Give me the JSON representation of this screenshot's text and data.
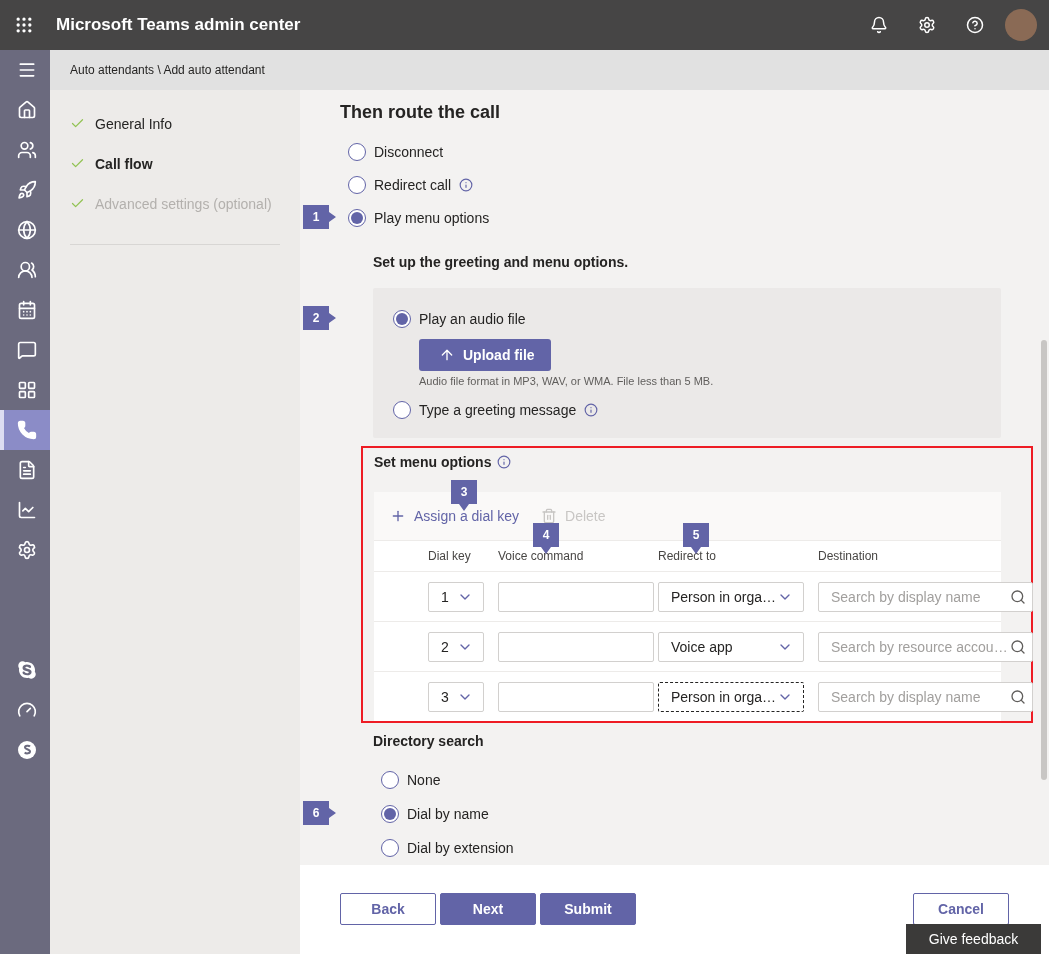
{
  "topbar": {
    "title": "Microsoft Teams admin center"
  },
  "rail": {
    "items": [
      {
        "kind": "menu",
        "selected": false
      },
      {
        "kind": "home",
        "selected": false
      },
      {
        "kind": "teams",
        "selected": false
      },
      {
        "kind": "rocket",
        "selected": false
      },
      {
        "kind": "globe",
        "selected": false
      },
      {
        "kind": "users",
        "selected": false
      },
      {
        "kind": "calendar",
        "selected": false
      },
      {
        "kind": "message",
        "selected": false
      },
      {
        "kind": "apps",
        "selected": false
      },
      {
        "kind": "phone",
        "selected": true
      },
      {
        "kind": "policy",
        "selected": false
      },
      {
        "kind": "analytics",
        "selected": false
      },
      {
        "kind": "settings",
        "selected": false
      }
    ],
    "bottom_items": [
      {
        "kind": "skype",
        "selected": false
      },
      {
        "kind": "gauge",
        "selected": false
      },
      {
        "kind": "skype-solid",
        "selected": false
      }
    ]
  },
  "breadcrumb": "Auto attendants \\ Add auto attendant",
  "steps": [
    {
      "label": "General Info",
      "done": true,
      "selected": false,
      "disabled": false
    },
    {
      "label": "Call flow",
      "done": true,
      "selected": true,
      "disabled": false
    },
    {
      "label": "Advanced settings (optional)",
      "done": true,
      "selected": false,
      "disabled": true
    }
  ],
  "route": {
    "heading": "Then route the call",
    "options": [
      {
        "label": "Disconnect",
        "selected": false
      },
      {
        "label": "Redirect call",
        "selected": false,
        "info": true
      },
      {
        "label": "Play menu options",
        "selected": true,
        "callout": "1"
      }
    ]
  },
  "greeting": {
    "heading": "Set up the greeting and menu options.",
    "options": [
      {
        "label": "Play an audio file",
        "selected": true,
        "callout": "2",
        "upload": {
          "label": "Upload file",
          "note": "Audio file format in MP3, WAV, or WMA. File less than 5 MB."
        }
      },
      {
        "label": "Type a greeting message",
        "selected": false,
        "info": true
      }
    ]
  },
  "menu_options": {
    "heading": "Set menu options",
    "info": true,
    "highlighted": true,
    "toolbar": [
      {
        "kind": "add",
        "label": "Assign a dial key",
        "disabled": false,
        "callout": "3"
      },
      {
        "kind": "delete",
        "label": "Delete",
        "disabled": true
      }
    ],
    "columns": [
      {
        "label": "Dial key"
      },
      {
        "label": "Voice command",
        "callout": "4"
      },
      {
        "label": "Redirect to",
        "callout": "5"
      },
      {
        "label": "Destination"
      }
    ],
    "rows": [
      {
        "dial_key": "1",
        "redirect_to": "Person in orga…",
        "destination_placeholder": "Search by display name",
        "focused": false
      },
      {
        "dial_key": "2",
        "redirect_to": "Voice app",
        "destination_placeholder": "Search by resource accou…",
        "focused": false
      },
      {
        "dial_key": "3",
        "redirect_to": "Person in orga…",
        "destination_placeholder": "Search by display name",
        "focused": true
      }
    ]
  },
  "directory": {
    "heading": "Directory search",
    "options": [
      {
        "label": "None",
        "selected": false
      },
      {
        "label": "Dial by name",
        "selected": true,
        "callout": "6"
      },
      {
        "label": "Dial by extension",
        "selected": false
      }
    ]
  },
  "footer": {
    "buttons": [
      {
        "label": "Back",
        "kind": "secondary"
      },
      {
        "label": "Next",
        "kind": "primary"
      },
      {
        "label": "Submit",
        "kind": "primary"
      }
    ],
    "cancel": {
      "label": "Cancel"
    },
    "feedback": "Give feedback"
  }
}
